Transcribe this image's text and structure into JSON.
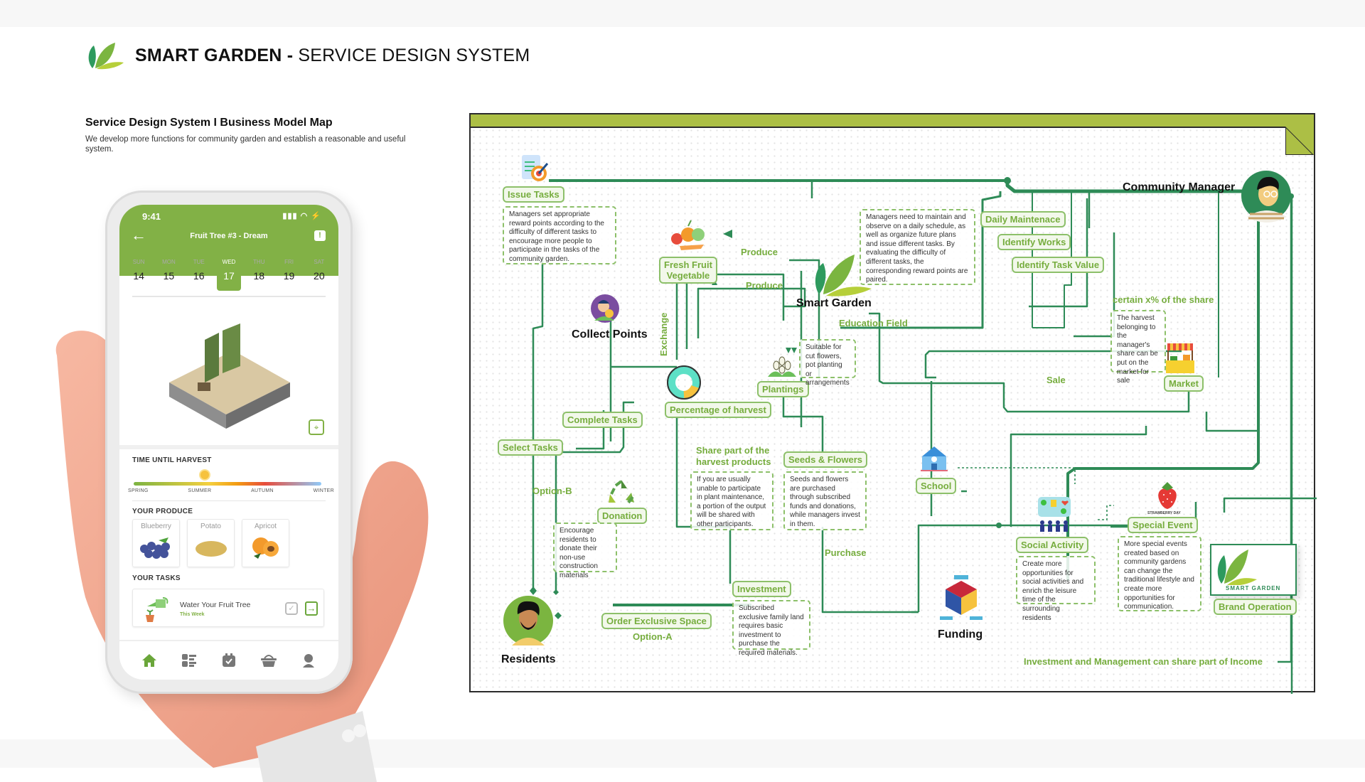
{
  "header": {
    "brand_bold": "SMART GARDEN -",
    "brand_rest": " SERVICE DESIGN SYSTEM",
    "section_title": "Service Design System I Business Model Map",
    "section_desc": "We develop more functions for community garden and establish a reasonable and useful system."
  },
  "phone": {
    "status_time": "9:41",
    "status_icons": "▮▮▮ ◠ ⚡",
    "back_icon": "←",
    "title": "Fruit Tree #3 - Dream",
    "alert_icon": "!",
    "week": [
      {
        "day": "SUN",
        "date": "14",
        "active": false
      },
      {
        "day": "MON",
        "date": "15",
        "active": false
      },
      {
        "day": "TUE",
        "date": "16",
        "active": false
      },
      {
        "day": "WED",
        "date": "17",
        "active": true
      },
      {
        "day": "THU",
        "date": "18",
        "active": false
      },
      {
        "day": "FRI",
        "date": "19",
        "active": false
      },
      {
        "day": "SAT",
        "date": "20",
        "active": false
      }
    ],
    "harvest_label": "TIME UNTIL HARVEST",
    "harvest_progress_season": "Summer",
    "seasons": [
      "SPRING",
      "SUMMER",
      "AUTUMN",
      "WINTER"
    ],
    "produce_label": "YOUR PRODUCE",
    "produce": [
      "Blueberry",
      "Potato",
      "Apricot"
    ],
    "tasks_label": "YOUR TASKS",
    "task": {
      "title": "Water Your Fruit Tree",
      "when": "This Week",
      "check_icon": "✓",
      "open_icon": "→"
    },
    "tabs": [
      "home",
      "list",
      "calendar",
      "basket",
      "profile"
    ]
  },
  "diagram": {
    "nodes": {
      "community_manager": "Community Manager",
      "smart_garden": "Smart Garden",
      "collect_points": "Collect Points",
      "residents": "Residents",
      "funding": "Funding"
    },
    "tags": {
      "issue_tasks": "Issue Tasks",
      "fresh_fruit_1": "Fresh Fruit",
      "fresh_fruit_2": "Vegetable",
      "daily_maintenance": "Daily Maintenace",
      "identify_works": "Identify Works",
      "identify_task_value": "Identify Task Value",
      "market": "Market",
      "plantings": "Plantings",
      "percentage_of_harvest": "Percentage of harvest",
      "complete_tasks": "Complete Tasks",
      "select_tasks": "Select Tasks",
      "seeds_flowers": "Seeds & Flowers",
      "school": "School",
      "donation": "Donation",
      "social_activity": "Social Activity",
      "special_event": "Special Event",
      "investment": "Investment",
      "order_exclusive_space": "Order Exclusive Space",
      "brand_operation": "Brand Operation"
    },
    "labels": {
      "produce_1": "Produce",
      "produce_2": "Produce",
      "education_field": "Education Field",
      "exchange": "Exchange",
      "certain_share": "certain x% of the share",
      "sale": "Sale",
      "share_part_1": "Share part of the",
      "share_part_2": "harvest products",
      "option_b": "Option-B",
      "option_a": "Option-A",
      "purchase": "Purchase",
      "income_share": "Investment and Management can share part of Income",
      "strawberry_day": "STRAWBERRY DAY",
      "brand_logo_text": "SMART GARDEN"
    },
    "notes": {
      "issue_tasks": "Managers set appropriate reward points according to the difficulty of different tasks to encourage more people to participate in the tasks of the community garden.",
      "daily_maintenance": "Managers need to maintain and observe on a daily schedule, as well as organize future plans and issue different tasks. By evaluating the difficulty of different tasks, the corresponding reward points are paired.",
      "market": "The harvest belonging to the manager's share can be put on the market for sale",
      "plantings": "Suitable for cut flowers, pot planting or arrangements",
      "share_harvest": "If you are usually unable to participate in plant maintenance, a portion of the output will be shared with other participants.",
      "seeds_flowers": "Seeds and flowers are purchased through subscribed funds and donations, while managers invest in them.",
      "donation": "Encourage residents to donate their non-use construction materials",
      "investment": "Subscribed exclusive family land requires basic investment to purchase the required materials.",
      "social_activity": "Create more opportunities for social activities and enrich the leisure time of the surrounding residents",
      "special_event": "More special events created based on community gardens can change the traditional lifestyle and create more opportunities for communication."
    },
    "colors": {
      "line": "#2e8b57",
      "tag_border": "#8dc06a",
      "tag_text": "#76ad3e",
      "header_bar": "#acbf45"
    }
  }
}
